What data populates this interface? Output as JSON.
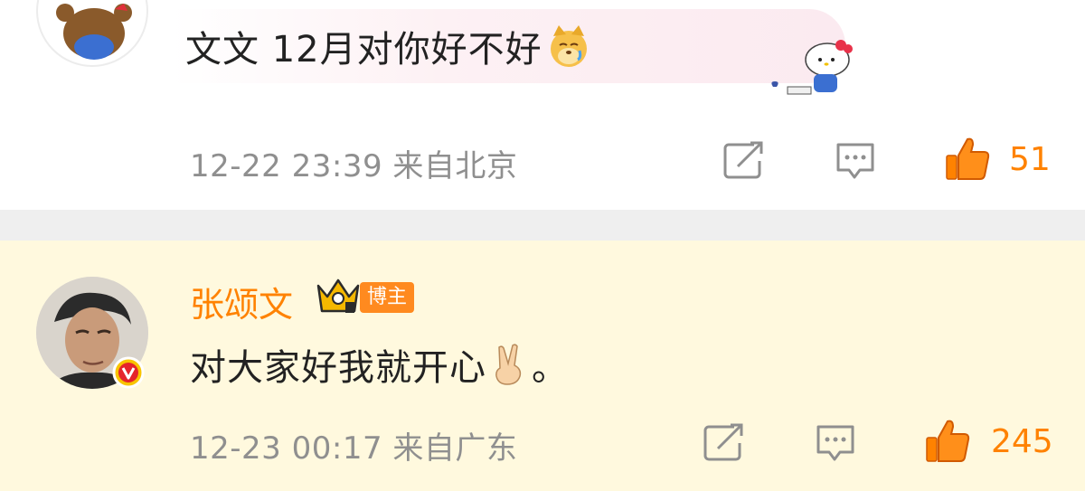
{
  "comment1": {
    "text": "文文 12月对你好不好",
    "emoji": "dog-cry-emoji",
    "meta": "12-22 23:39 来自北京",
    "likes": "51",
    "bubble_decoration": "hello-kitty-sticker"
  },
  "comment2": {
    "username": "张颂文",
    "badge": "博主",
    "text": "对大家好我就开心",
    "emoji": "victory-hand-emoji",
    "text_suffix": "。",
    "meta": "12-23 00:17 来自广东",
    "likes": "245"
  },
  "colors": {
    "accent": "#ff8200",
    "meta_gray": "#8f8f8f",
    "highlight_bg": "#fff9de",
    "divider": "#efefef"
  }
}
